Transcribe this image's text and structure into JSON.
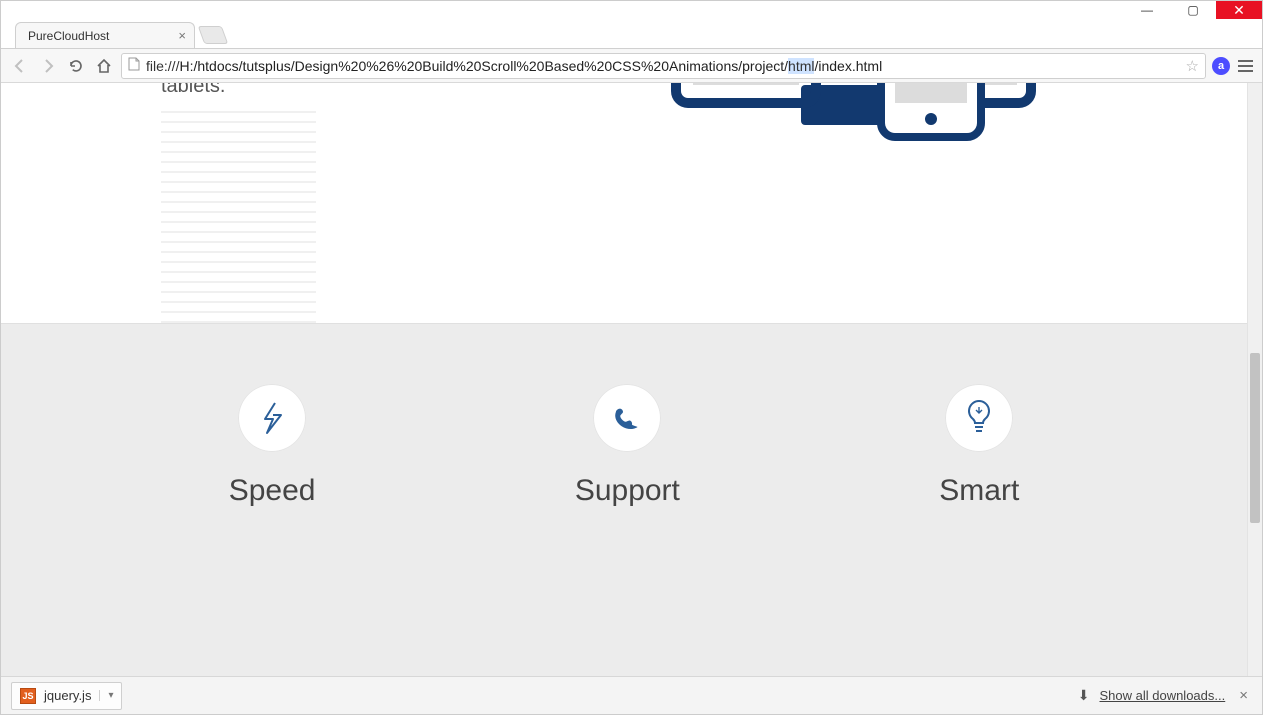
{
  "window": {
    "minimize": "—",
    "maximize": "▢",
    "close": "✕"
  },
  "tab": {
    "title": "PureCloudHost",
    "close": "×"
  },
  "omnibox": {
    "scheme": "file:///",
    "path": "H:/htdocs/tutsplus/Design%20%26%20Build%20Scroll%20Based%20CSS%20Animations/project/",
    "segment_highlight": "html",
    "tail": "/index.html"
  },
  "hero": {
    "text_fragment": "tablets."
  },
  "features": [
    {
      "title": "Speed",
      "icon": "bolt"
    },
    {
      "title": "Support",
      "icon": "phone"
    },
    {
      "title": "Smart",
      "icon": "bulb"
    }
  ],
  "downloads": {
    "item": "jquery.js",
    "show_all": "Show all downloads...",
    "close": "×"
  }
}
